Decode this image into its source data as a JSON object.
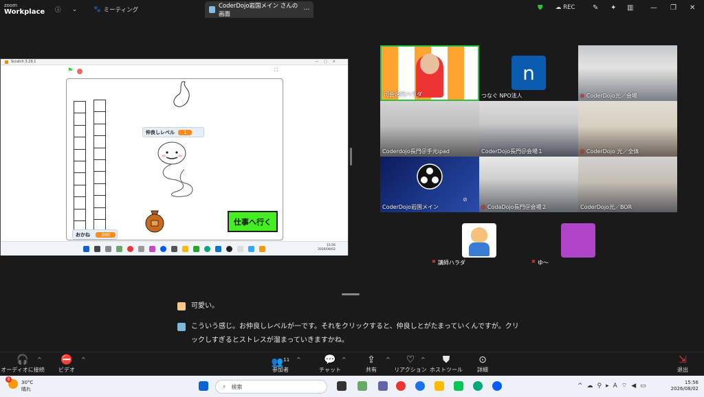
{
  "app": {
    "logo_line1": "zoom",
    "logo_line2": "Workplace",
    "meeting_tab": "ミーティング",
    "share_tab": "CoderDojo岩国メイン さんの画面",
    "rec_label": "REC"
  },
  "scratch": {
    "window_title": "Scratch 3.29.1",
    "level_label": "仲良しレベル",
    "level_value": "1",
    "money_label": "おかね",
    "money_value": "300",
    "go_button": "仕事へ行く",
    "clock_time": "15:56",
    "clock_date": "2026/08/02"
  },
  "gallery": {
    "tiles": [
      {
        "label": "司会進行ハラダ",
        "mic_off": false
      },
      {
        "label": "つなぐ NPO法人",
        "mic_off": false,
        "avatar_letter": "n"
      },
      {
        "label": "CoderDojo光／会場",
        "mic_off": true
      },
      {
        "label": "Coderdojo長門＠手元ipad",
        "mic_off": false
      },
      {
        "label": "CoderDojo長門＠会場１",
        "mic_off": false
      },
      {
        "label": "CoderDojo 光／全体",
        "mic_off": true
      },
      {
        "label": "CoderDojo岩国メイン",
        "mic_off": false
      },
      {
        "label": "CodaDojo長門＠会場２",
        "mic_off": true
      },
      {
        "label": "CoderDojo光／BOR",
        "mic_off": false
      }
    ],
    "extra": [
      {
        "label": "講師ハラダ",
        "mic_off": true
      },
      {
        "label": "ゆ〜",
        "mic_off": true
      }
    ]
  },
  "captions": [
    "可愛い。",
    "こういう感じ。お仲良しレベルが一です。それをクリックすると、仲良しとがたまっていくんですが。クリックしすぎるとストレスが溜まっていきますかね。"
  ],
  "toolbar": {
    "audio": "オーディオに接続",
    "video": "ビデオ",
    "participants": "参加者",
    "participants_count": "11",
    "chat": "チャット",
    "share": "共有",
    "reactions": "リアクション",
    "host_tools": "ホストツール",
    "more": "詳細",
    "leave": "退出"
  },
  "taskbar": {
    "temp": "30°C",
    "weather": "晴れ",
    "badge": "8",
    "search_placeholder": "検索",
    "time": "15:56",
    "date": "2026/08/02"
  },
  "colors": {
    "accent_orange": "#ff8c1a",
    "go_green": "#44ee22",
    "zoom_blue": "#0b5cff",
    "active_border": "#2fbf3f"
  }
}
